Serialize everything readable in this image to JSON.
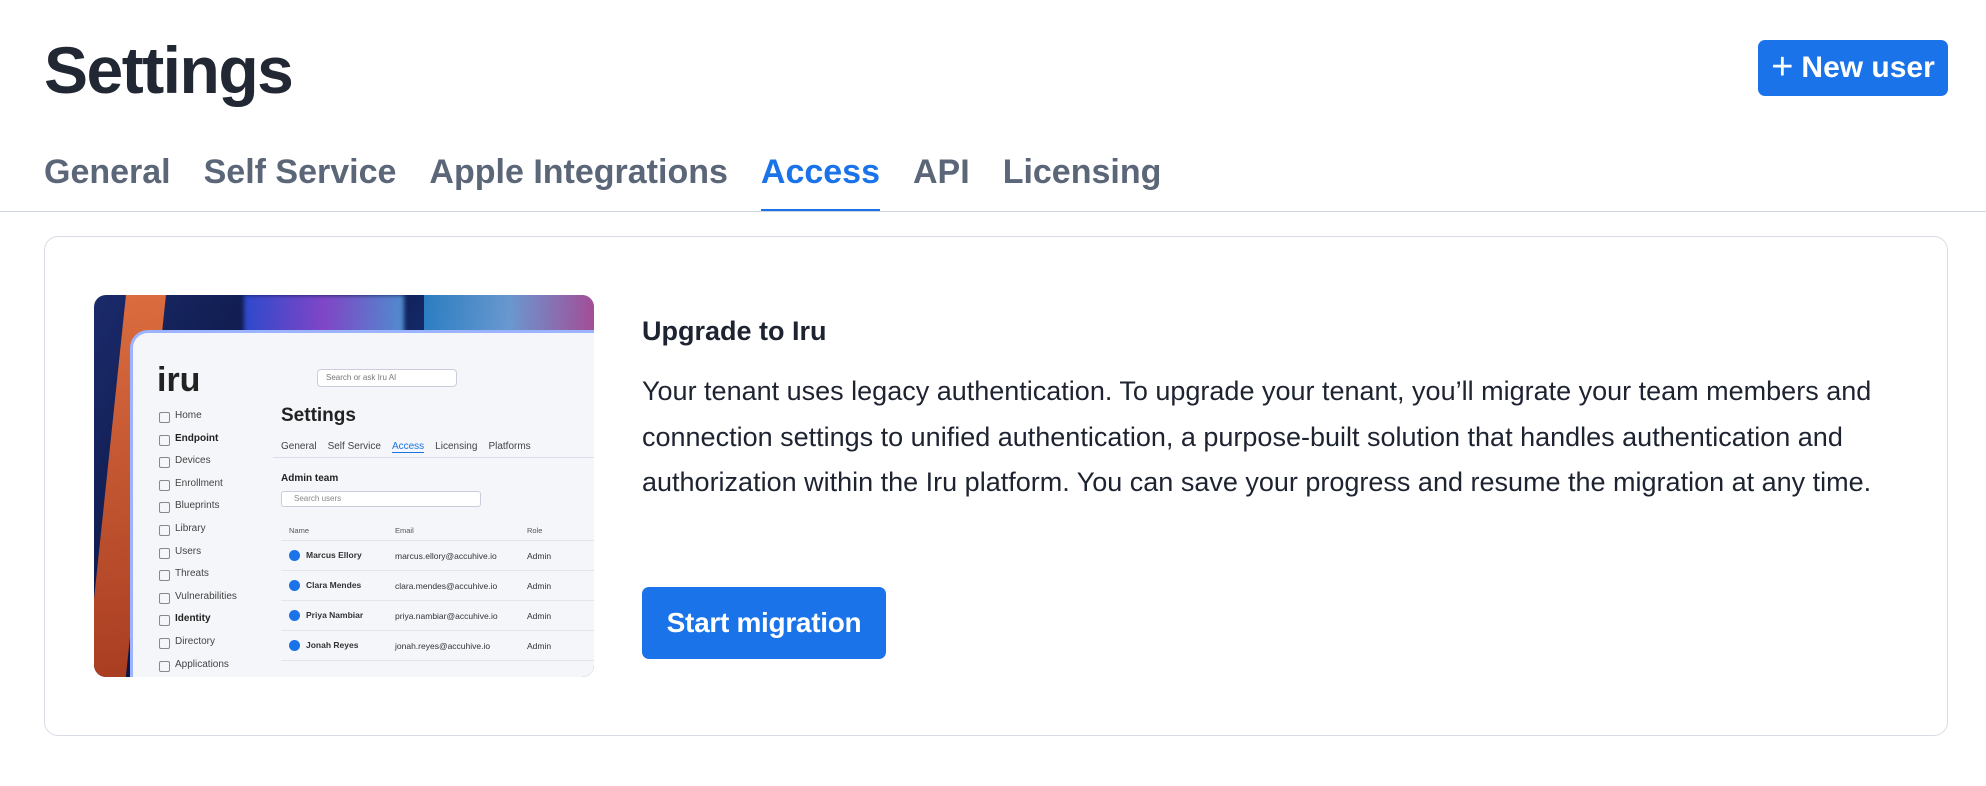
{
  "header": {
    "title": "Settings",
    "new_user_label": "New user"
  },
  "tabs": [
    {
      "label": "General",
      "active": false
    },
    {
      "label": "Self Service",
      "active": false
    },
    {
      "label": "Apple Integrations",
      "active": false
    },
    {
      "label": "Access",
      "active": true
    },
    {
      "label": "API",
      "active": false
    },
    {
      "label": "Licensing",
      "active": false
    }
  ],
  "upgrade_card": {
    "title": "Upgrade to Iru",
    "body": "Your tenant uses legacy authentication. To upgrade your tenant, you’ll migrate your team members and connection settings to unified authentication, a purpose-built solution that handles authentication and authorization within the Iru platform. You can save your progress and resume the migration at any time.",
    "button_label": "Start migration",
    "preview": {
      "logo": "iru",
      "search_placeholder": "Search or ask Iru AI",
      "title": "Settings",
      "tabs": [
        "General",
        "Self Service",
        "Access",
        "Licensing",
        "Platforms"
      ],
      "active_tab": "Access",
      "sidebar": [
        "Home",
        "Endpoint",
        "Devices",
        "Enrollment",
        "Blueprints",
        "Library",
        "Users",
        "Threats",
        "Vulnerabilities",
        "Identity",
        "Directory",
        "Applications"
      ],
      "section": "Admin team",
      "search_users": "Search users",
      "columns": [
        "Name",
        "Email",
        "Role"
      ],
      "rows": [
        {
          "name": "Marcus Ellory",
          "email": "marcus.ellory@accuhive.io",
          "role": "Admin"
        },
        {
          "name": "Clara Mendes",
          "email": "clara.mendes@accuhive.io",
          "role": "Admin"
        },
        {
          "name": "Priya Nambiar",
          "email": "priya.nambiar@accuhive.io",
          "role": "Admin"
        },
        {
          "name": "Jonah Reyes",
          "email": "jonah.reyes@accuhive.io",
          "role": "Admin"
        }
      ]
    }
  },
  "colors": {
    "accent": "#1a73e8",
    "tab_inactive": "#5b6678",
    "title": "#222833"
  }
}
